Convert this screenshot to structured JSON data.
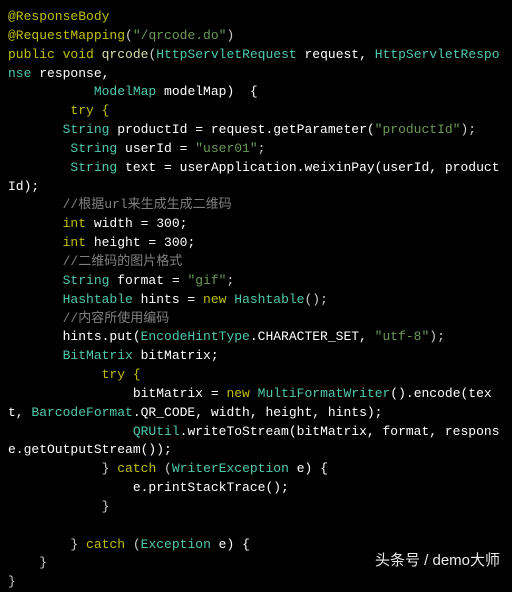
{
  "code": {
    "l1_anno": "@ResponseBody",
    "l2_anno": "@RequestMapping",
    "l2_paren_open": "(",
    "l2_str": "\"/qrcode.do\"",
    "l2_paren_close": ")",
    "l3_kw_public": "public ",
    "l3_kw_void": "void ",
    "l3_fn": "qrcode",
    "l3_open": "(",
    "l3_type1": "HttpServletRequest ",
    "l3_arg1": "request, ",
    "l3_type2": "HttpServletResponse ",
    "l3_arg2": "response,",
    "l4_indent": "\n           ",
    "l4_type": "ModelMap ",
    "l4_arg": "modelMap)  {",
    "l5": "        try {",
    "l6_pre": "       ",
    "l6_type": "String ",
    "l6_var": "productId = ",
    "l6_cont": "request.getParameter(",
    "l6_str": "\"productId\"",
    "l6_end": ");",
    "l7_pre": "        ",
    "l7_type": "String ",
    "l7_var": "userId = ",
    "l7_str": "\"user01\"",
    "l7_end": ";",
    "l8_pre": "        ",
    "l8_type": "String ",
    "l8_var": "text = userApplication.weixinPay(userId, productId);",
    "cmt1": "       //根据url来生成生成二维码",
    "l9_pre": "       ",
    "l9_kw": "int ",
    "l9_rest": "width = 300;",
    "l10_pre": "       ",
    "l10_kw": "int ",
    "l10_rest": "height = 300;",
    "cmt2": "       //二维码的图片格式",
    "l11_pre": "       ",
    "l11_type": "String ",
    "l11_var": "format = ",
    "l11_str": "\"gif\"",
    "l11_end": ";",
    "l12_pre": "       ",
    "l12_type": "Hashtable ",
    "l12_var": "hints = ",
    "l12_kw": "new ",
    "l12_type2": "Hashtable",
    "l12_end": "();",
    "cmt3": "       //内容所使用编码",
    "l13_pre": "       ",
    "l13_call": "hints.put(",
    "l13_type": "EncodeHintType",
    "l13_dot": ".CHARACTER_SET, ",
    "l13_str": "\"utf-8\"",
    "l13_end": ");",
    "l14_pre": "       ",
    "l14_type": "BitMatrix ",
    "l14_var": "bitMatrix;",
    "l15": "            try {",
    "l16_pre": "                ",
    "l16_var": "bitMatrix = ",
    "l16_kw": "new ",
    "l16_type": "MultiFormatWriter",
    "l16_mid": "().encode(text, ",
    "l16_type2": "BarcodeFormat",
    "l16_end": ".QR_CODE, width, height, hints);",
    "l17_pre": "                ",
    "l17_type": "QRUtil",
    "l17_rest": ".writeToStream(bitMatrix, format, response.getOutputStream());",
    "l18_pre": "            } ",
    "l18_kw": "catch ",
    "l18_open": "(",
    "l18_type": "WriterException ",
    "l18_var": "e) {",
    "l19": "                e.printStackTrace();",
    "l20": "            }",
    "blank": "",
    "l21_pre": "        } ",
    "l21_kw": "catch ",
    "l21_open": "(",
    "l21_type": "Exception ",
    "l21_var": "e) {",
    "l22": "    }",
    "l23": "}"
  },
  "watermark": "头条号 / demo大师"
}
